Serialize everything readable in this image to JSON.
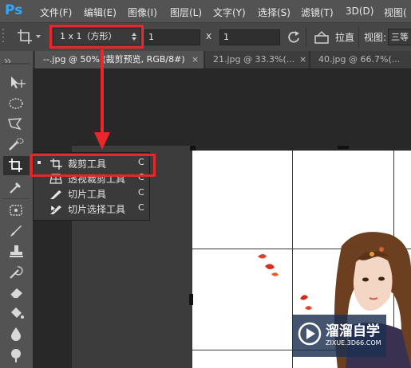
{
  "app": {
    "logo": "Ps"
  },
  "menu": [
    "文件(F)",
    "编辑(E)",
    "图像(I)",
    "图层(L)",
    "文字(Y)",
    "选择(S)",
    "滤镜(T)",
    "3D(D)",
    "视图("
  ],
  "options": {
    "ratio_select": "1 x 1（方形）",
    "width_value": "1",
    "times": "x",
    "height_value": "1",
    "straighten_label": "拉直",
    "view_label": "视图:",
    "view_value": "三等"
  },
  "tabs": [
    {
      "label": "--.jpg @ 50% (裁剪预览, RGB/8#)",
      "close": "×",
      "active": true
    },
    {
      "label": "21.jpg @ 33.3%(...",
      "close": "×",
      "active": false
    },
    {
      "label": "40.jpg @ 66.7%(...",
      "close": "",
      "active": false
    }
  ],
  "flyout": [
    {
      "label": "裁剪工具",
      "key": "C",
      "selected": true
    },
    {
      "label": "透视裁剪工具",
      "key": "C",
      "selected": false
    },
    {
      "label": "切片工具",
      "key": "C",
      "selected": false
    },
    {
      "label": "切片选择工具",
      "key": "C",
      "selected": false
    }
  ],
  "tools": [
    "move-tool",
    "marquee-tool",
    "lasso-tool",
    "quick-select-tool",
    "crop-tool",
    "eyedropper-tool",
    "healing-tool",
    "brush-tool",
    "stamp-tool",
    "history-brush-tool",
    "eraser-tool",
    "paint-bucket-tool",
    "blur-tool",
    "dodge-tool"
  ],
  "watermark": {
    "title": "溜溜自学",
    "url": "ZIXUE.3D66.COM"
  },
  "colors": {
    "highlight": "#e9262b",
    "ps_blue": "#31a8ff",
    "ui_dark": "#535353"
  }
}
